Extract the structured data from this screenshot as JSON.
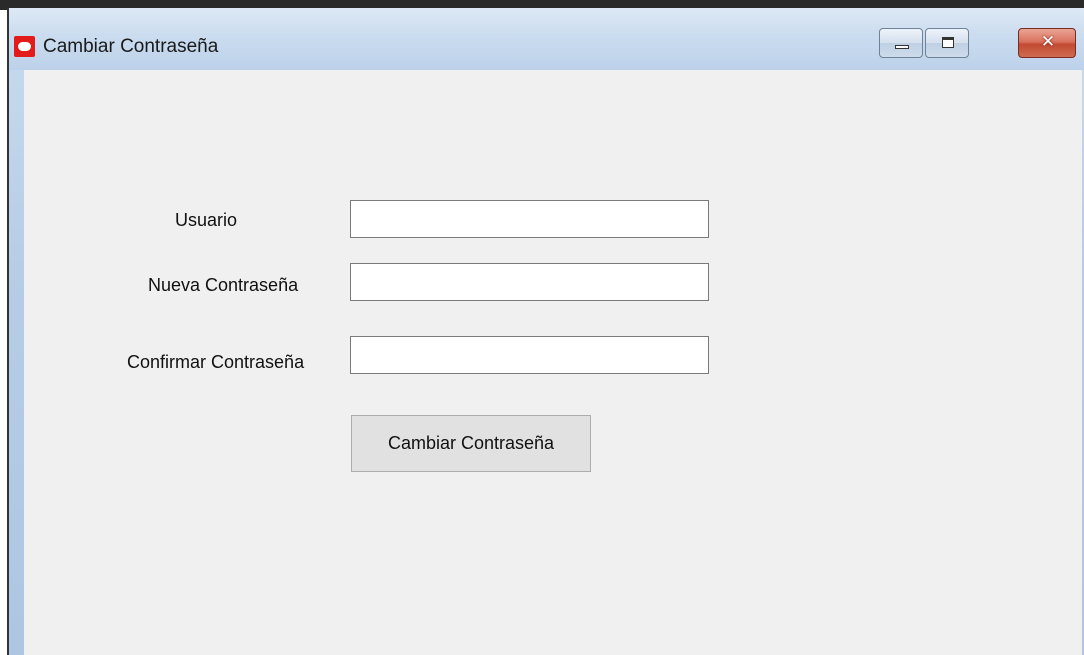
{
  "window": {
    "title": "Cambiar Contraseña",
    "icon": "oracle-logo-icon",
    "controls": {
      "minimize": "minimize-icon",
      "maximize": "maximize-icon",
      "close": "close-icon",
      "close_glyph": "✕"
    }
  },
  "form": {
    "usuario": {
      "label": "Usuario",
      "value": ""
    },
    "nueva": {
      "label": "Nueva Contraseña",
      "value": ""
    },
    "confirmar": {
      "label": "Confirmar Contraseña",
      "value": ""
    },
    "submit_label": "Cambiar Contraseña"
  },
  "colors": {
    "client_background": "#f0f0f0",
    "titlebar": "#cbdcef",
    "close_button": "#c24a33",
    "icon_red": "#e21b1b"
  }
}
